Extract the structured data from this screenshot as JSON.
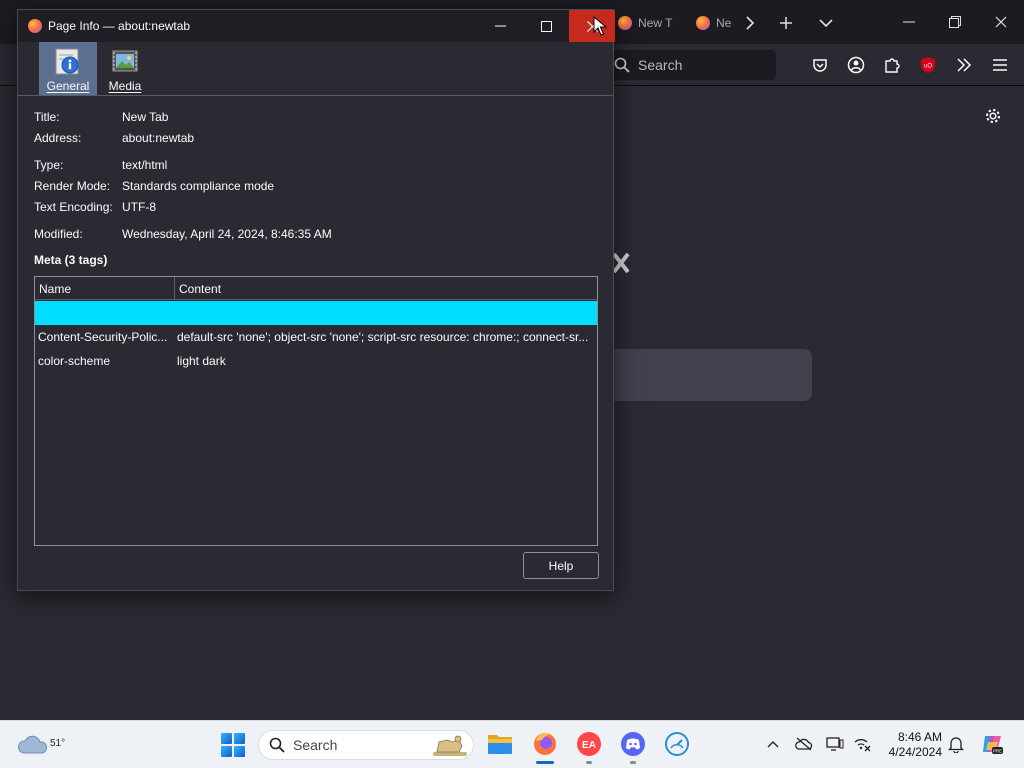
{
  "browser": {
    "tabs": [
      {
        "label": "New T"
      },
      {
        "label": "Ne"
      }
    ],
    "search_placeholder": "Search"
  },
  "dialog": {
    "title": "Page Info — about:newtab",
    "toolbar": {
      "general_label": "General",
      "media_label": "Media"
    },
    "fields": {
      "title_label": "Title:",
      "title_value": "New Tab",
      "address_label": "Address:",
      "address_value": "about:newtab",
      "type_label": "Type:",
      "type_value": "text/html",
      "render_label": "Render Mode:",
      "render_value": "Standards compliance mode",
      "encoding_label": "Text Encoding:",
      "encoding_value": "UTF-8",
      "modified_label": "Modified:",
      "modified_value": "Wednesday, April 24, 2024, 8:46:35 AM"
    },
    "meta": {
      "heading": "Meta (3 tags)",
      "columns": [
        "Name",
        "Content"
      ],
      "rows": [
        {
          "name": "",
          "content": ""
        },
        {
          "name": "Content-Security-Polic...",
          "content": "default-src 'none'; object-src 'none'; script-src resource: chrome:; connect-sr..."
        },
        {
          "name": "color-scheme",
          "content": "light dark"
        }
      ]
    },
    "help_label": "Help"
  },
  "taskbar": {
    "weather_temp": "51°",
    "search_placeholder": "Search",
    "time": "8:46 AM",
    "date": "4/24/2024"
  },
  "colors": {
    "selected_row": "#00ddff",
    "close_button": "#c42b1c",
    "general_tab_active": "#5d6f8f"
  }
}
